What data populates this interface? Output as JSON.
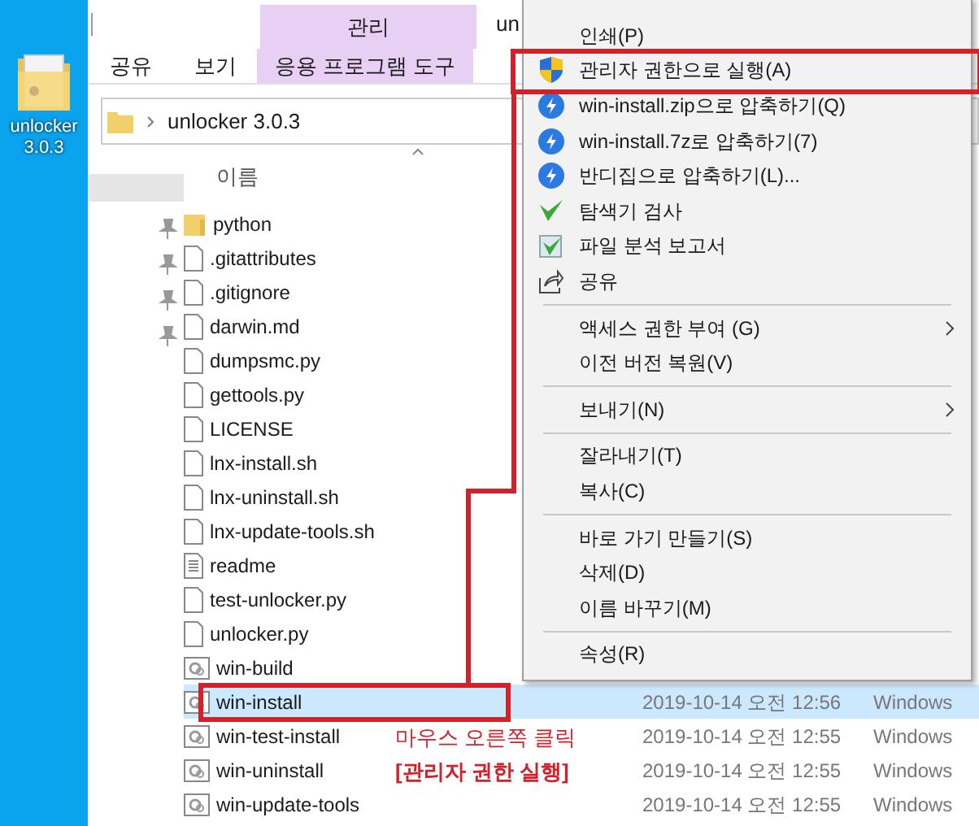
{
  "desktop_icon": {
    "label": "unlocker 3.0.3"
  },
  "ribbon": {
    "context_group": "관리",
    "title": "un",
    "tabs": [
      {
        "label": "공유",
        "kind": "normal",
        "selected": false
      },
      {
        "label": "보기",
        "kind": "normal",
        "selected": false
      },
      {
        "label": "응용 프로그램 도구",
        "kind": "contextual",
        "selected": false
      }
    ]
  },
  "address_bar": {
    "path": "unlocker 3.0.3"
  },
  "file_list": {
    "name_column": "이름",
    "rows": [
      {
        "name": "python",
        "kind": "folder",
        "selected": false
      },
      {
        "name": ".gitattributes",
        "kind": "file",
        "selected": false
      },
      {
        "name": ".gitignore",
        "kind": "file",
        "selected": false
      },
      {
        "name": "darwin.md",
        "kind": "file",
        "selected": false
      },
      {
        "name": "dumpsmc.py",
        "kind": "file",
        "selected": false
      },
      {
        "name": "gettools.py",
        "kind": "file",
        "selected": false
      },
      {
        "name": "LICENSE",
        "kind": "file",
        "selected": false
      },
      {
        "name": "lnx-install.sh",
        "kind": "file",
        "selected": false
      },
      {
        "name": "lnx-uninstall.sh",
        "kind": "file",
        "selected": false
      },
      {
        "name": "lnx-update-tools.sh",
        "kind": "file",
        "selected": false
      },
      {
        "name": "readme",
        "kind": "text",
        "selected": false
      },
      {
        "name": "test-unlocker.py",
        "kind": "file",
        "selected": false
      },
      {
        "name": "unlocker.py",
        "kind": "file",
        "selected": false
      },
      {
        "name": "win-build",
        "kind": "script",
        "selected": false
      },
      {
        "name": "win-install",
        "kind": "script",
        "selected": true,
        "date": "2019-10-14 오전 12:56",
        "type": "Windows"
      },
      {
        "name": "win-test-install",
        "kind": "script",
        "selected": false,
        "date": "2019-10-14 오전 12:55",
        "type": "Windows"
      },
      {
        "name": "win-uninstall",
        "kind": "script",
        "selected": false,
        "date": "2019-10-14 오전 12:55",
        "type": "Windows"
      },
      {
        "name": "win-update-tools",
        "kind": "script",
        "selected": false,
        "date": "2019-10-14 오전 12:55",
        "type": "Windows"
      }
    ]
  },
  "context_menu": {
    "items": [
      {
        "kind": "plain",
        "label": "인쇄(P)"
      },
      {
        "kind": "shield",
        "label": "관리자 권한으로 실행(A)"
      },
      {
        "kind": "compress",
        "label": "win-install.zip으로 압축하기(Q)"
      },
      {
        "kind": "compress",
        "label": "win-install.7z로 압축하기(7)"
      },
      {
        "kind": "compress",
        "label": "반디집으로 압축하기(L)..."
      },
      {
        "kind": "scan",
        "label": "탐색기 검사"
      },
      {
        "kind": "report",
        "label": "파일 분석 보고서"
      },
      {
        "kind": "share",
        "label": "공유"
      },
      {
        "kind": "separator"
      },
      {
        "kind": "submenu",
        "label": "액세스 권한 부여 (G)"
      },
      {
        "kind": "plain",
        "label": "이전 버전 복원(V)"
      },
      {
        "kind": "separator"
      },
      {
        "kind": "submenu",
        "label": "보내기(N)"
      },
      {
        "kind": "separator"
      },
      {
        "kind": "plain",
        "label": "잘라내기(T)"
      },
      {
        "kind": "plain",
        "label": "복사(C)"
      },
      {
        "kind": "separator"
      },
      {
        "kind": "plain",
        "label": "바로 가기 만들기(S)"
      },
      {
        "kind": "plain",
        "label": "삭제(D)"
      },
      {
        "kind": "plain",
        "label": "이름 바꾸기(M)"
      },
      {
        "kind": "separator"
      },
      {
        "kind": "plain",
        "label": "속성(R)"
      }
    ]
  },
  "annotation": {
    "lines": [
      "마우스 오른쪽 클릭",
      "[관리자 권한 실행]"
    ]
  }
}
